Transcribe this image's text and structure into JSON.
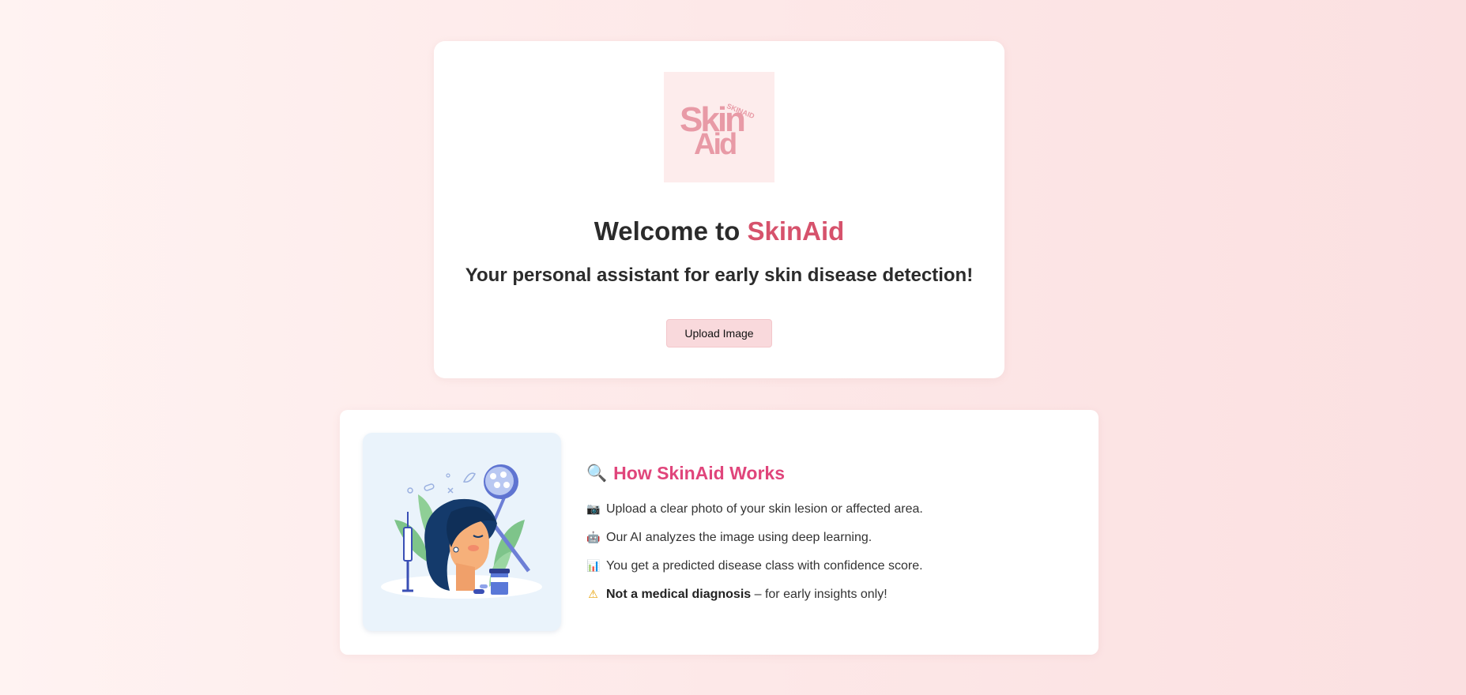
{
  "welcome": {
    "logo_text_top": "Skin",
    "logo_text_bottom": "Aid",
    "logo_small_text": "SKINAID",
    "title_prefix": "Welcome to ",
    "title_brand": "SkinAid",
    "subtitle": "Your personal assistant for early skin disease detection!",
    "upload_button": "Upload Image"
  },
  "how": {
    "icon": "magnifier-icon",
    "icon_glyph": "🔍",
    "title": "How SkinAid Works",
    "steps": [
      {
        "icon": "camera-icon",
        "glyph": "📷",
        "text": "Upload a clear photo of your skin lesion or affected area."
      },
      {
        "icon": "robot-icon",
        "glyph": "🤖",
        "text": "Our AI analyzes the image using deep learning."
      },
      {
        "icon": "bar-chart-icon",
        "glyph": "📊",
        "text": "You get a predicted disease class with confidence score."
      },
      {
        "icon": "warning-icon",
        "glyph": "⚠",
        "bold": "Not a medical diagnosis",
        "text": " – for early insights only!"
      }
    ]
  },
  "colors": {
    "brand": "#d6526c",
    "how_title": "#e0457b",
    "button_bg": "#f9d9dc",
    "logo_bg": "#fdecec",
    "logo_text": "#e89aa6",
    "illustration_bg": "#eaf3fb"
  }
}
